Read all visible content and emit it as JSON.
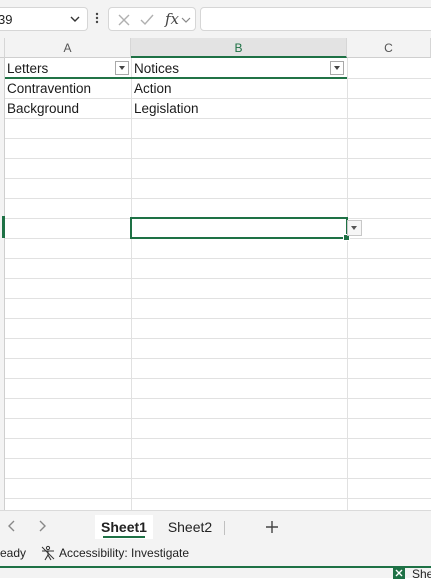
{
  "formula_bar": {
    "name_box_value": "39",
    "fx_label": "fx",
    "formula_value": ""
  },
  "columns": [
    {
      "id": "col-a",
      "label": "A"
    },
    {
      "id": "col-b",
      "label": "B"
    },
    {
      "id": "col-c",
      "label": "C"
    }
  ],
  "table": {
    "headers": [
      "Letters",
      "Notices"
    ],
    "rows": [
      [
        "Contravention",
        "Action"
      ],
      [
        "Background",
        "Legislation"
      ]
    ]
  },
  "sheets": {
    "tabs": [
      "Sheet1",
      "Sheet2"
    ],
    "active": "Sheet1",
    "add_label": "+"
  },
  "status_bar": {
    "ready_text": "eady",
    "accessibility_text": "Accessibility: Investigate",
    "sheet_view_text": "She"
  },
  "colors": {
    "accent": "#1e7145",
    "header_bg": "#f3f3f3",
    "grid_line": "#e1e1e1"
  },
  "icons": {
    "name_box_dropdown": "chevron-down-icon",
    "cancel": "x-icon",
    "enter": "check-icon",
    "function": "fx-icon",
    "accessibility": "accessibility-icon",
    "filter": "filter-dropdown-icon"
  }
}
